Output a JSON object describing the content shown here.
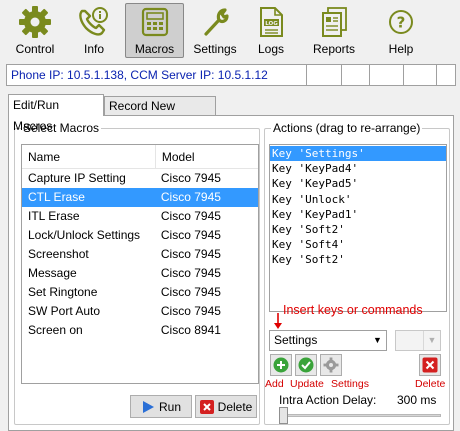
{
  "toolbar": {
    "items": [
      {
        "label": "Control",
        "icon": "gear-icon",
        "active": false
      },
      {
        "label": "Info",
        "icon": "phone-info-icon",
        "active": false
      },
      {
        "label": "Macros",
        "icon": "phone-keypad-icon",
        "active": true
      },
      {
        "label": "Settings",
        "icon": "wrench-icon",
        "active": false
      },
      {
        "label": "Logs",
        "icon": "log-document-icon",
        "active": false
      },
      {
        "label": "Reports",
        "icon": "report-icon",
        "active": false
      },
      {
        "label": "Help",
        "icon": "help-icon",
        "active": false
      }
    ]
  },
  "status": {
    "text": "Phone IP: 10.5.1.138, CCM Server IP: 10.5.1.12"
  },
  "tabs": [
    {
      "label": "Edit/Run Macros",
      "active": true
    },
    {
      "label": "Record New Macros",
      "active": false
    }
  ],
  "select_macros": {
    "title": "Select Macros",
    "columns": [
      "Name",
      "Model"
    ],
    "rows": [
      {
        "name": "Capture IP Setting",
        "model": "Cisco 7945",
        "selected": false
      },
      {
        "name": "CTL Erase",
        "model": "Cisco 7945",
        "selected": true
      },
      {
        "name": "ITL Erase",
        "model": "Cisco 7945",
        "selected": false
      },
      {
        "name": "Lock/Unlock Settings",
        "model": "Cisco 7945",
        "selected": false
      },
      {
        "name": "Screenshot",
        "model": "Cisco 7945",
        "selected": false
      },
      {
        "name": "Message",
        "model": "Cisco 7945",
        "selected": false
      },
      {
        "name": "Set Ringtone",
        "model": "Cisco 7945",
        "selected": false
      },
      {
        "name": "SW Port Auto",
        "model": "Cisco 7945",
        "selected": false
      },
      {
        "name": "Screen on",
        "model": "Cisco 8941",
        "selected": false
      }
    ],
    "run_label": "Run",
    "delete_label": "Delete"
  },
  "actions": {
    "title": "Actions (drag to re-arrange)",
    "items": [
      {
        "text": "Key 'Settings'",
        "selected": true
      },
      {
        "text": "Key 'KeyPad4'",
        "selected": false
      },
      {
        "text": "Key 'KeyPad5'",
        "selected": false
      },
      {
        "text": "Key 'Unlock'",
        "selected": false
      },
      {
        "text": "Key 'KeyPad1'",
        "selected": false
      },
      {
        "text": "Key 'Soft2'",
        "selected": false
      },
      {
        "text": "Key 'Soft4'",
        "selected": false
      },
      {
        "text": "Key 'Soft2'",
        "selected": false
      }
    ],
    "insert_hint": "Insert keys or commands",
    "command_select_value": "Settings",
    "add_label": "Add",
    "update_label": "Update",
    "settings_label": "Settings",
    "delete_label": "Delete",
    "delay_label": "Intra Action Delay:",
    "delay_value": "300 ms",
    "delay_fraction": 0.0
  },
  "colors": {
    "status_text": "#0a22b0",
    "selection": "#3399ff",
    "hint_red": "#e00000"
  }
}
